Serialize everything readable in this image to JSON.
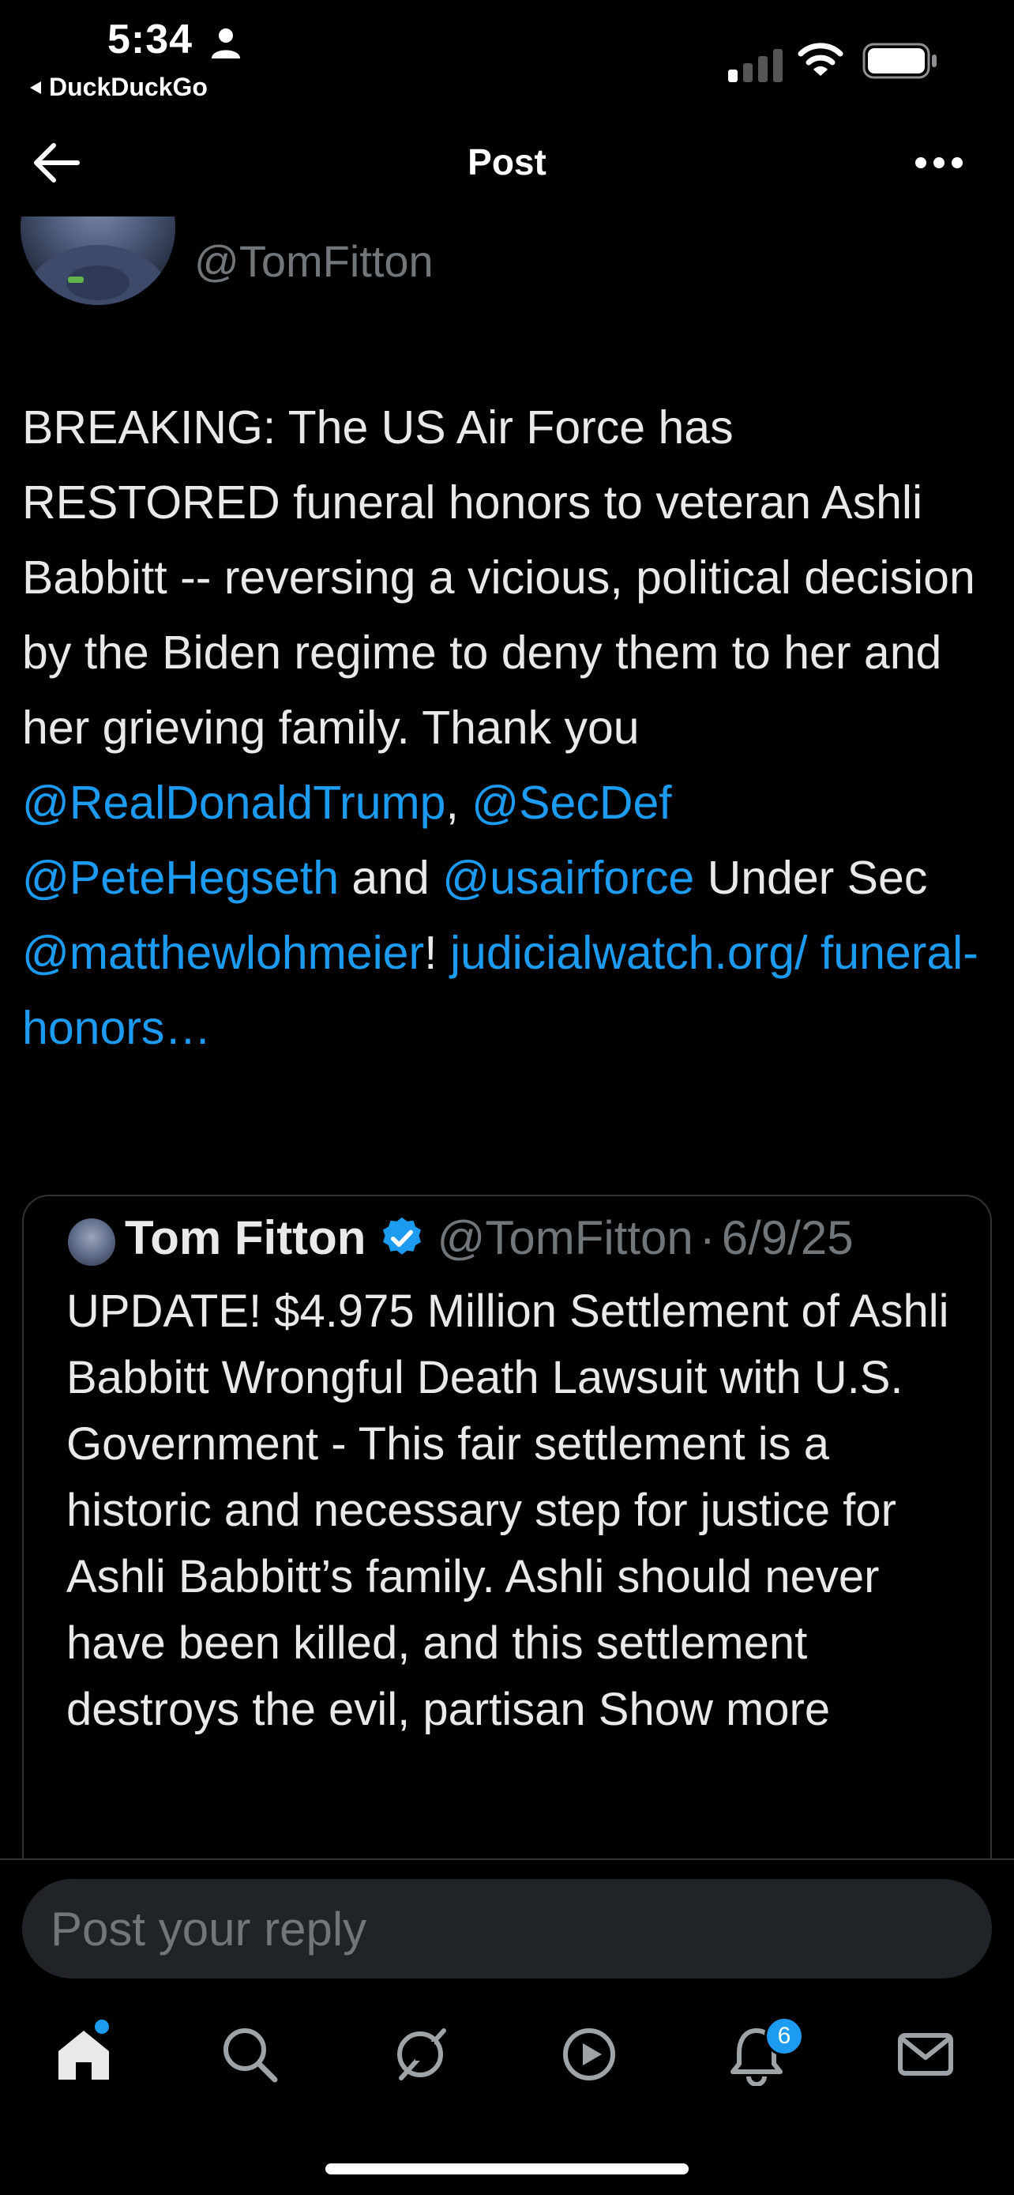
{
  "status_bar": {
    "time": "5:34",
    "back_app": "DuckDuckGo"
  },
  "nav": {
    "title": "Post"
  },
  "post": {
    "author_handle": "@TomFitton",
    "text_parts": {
      "p1": "BREAKING: The US Air Force has RESTORED funeral honors to veteran Ashli Babbitt -- reversing a vicious, political decision by the Biden regime to deny them to her and her grieving family. Thank you ",
      "m1": "@RealDonaldTrump",
      "p2": ", ",
      "m2": "@SecDef",
      "p3": " ",
      "m3": "@PeteHegseth",
      "p4": " and ",
      "m4": "@usairforce",
      "p5": " Under Sec ",
      "m5": "@matthewlohmeier",
      "p6": "! ",
      "link": "judicialwatch.org/ funeral-honors…"
    }
  },
  "quoted": {
    "name": "Tom Fitton",
    "handle": "@TomFitton",
    "separator": "·",
    "date": "6/9/25",
    "text": "UPDATE! $4.975 Million Settlement of Ashli Babbitt Wrongful Death Lawsuit with U.S. Government - This fair settlement is a historic and necessary step for justice for Ashli Babbitt’s family. Ashli should never have been killed, and this settlement destroys the evil, partisan",
    "show_more": "Show more"
  },
  "reply": {
    "placeholder": "Post your reply"
  },
  "tabbar": {
    "notification_count": "6"
  },
  "colors": {
    "accent": "#1d9bf0",
    "background": "#000000",
    "text": "#e7e9ea",
    "muted": "#71767b"
  }
}
